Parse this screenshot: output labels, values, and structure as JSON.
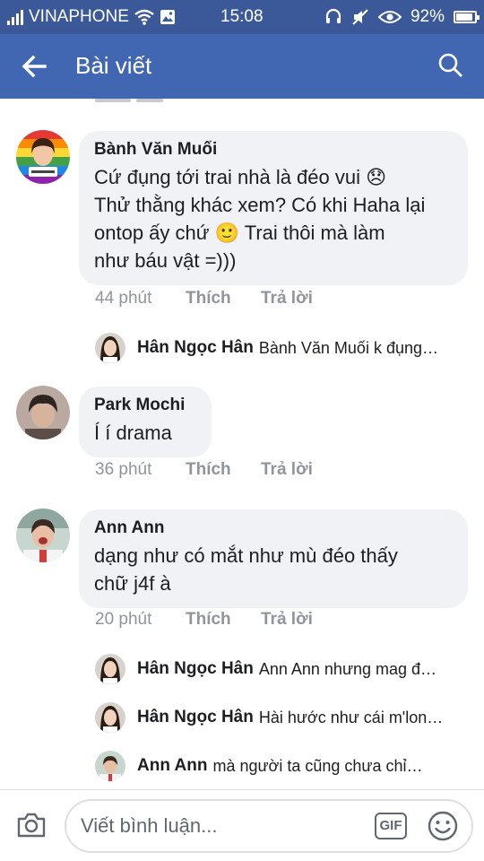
{
  "status_bar": {
    "carrier": "VINAPHONE",
    "time": "15:08",
    "battery": "92%",
    "battery_level": 0.92,
    "icons": [
      "signal-icon",
      "wifi-icon",
      "gallery-icon",
      "headset-icon",
      "mute-icon",
      "eye-icon",
      "battery-icon"
    ]
  },
  "app_bar": {
    "title": "Bài viết",
    "icons": [
      "back-arrow-icon",
      "search-icon"
    ]
  },
  "comments": [
    {
      "author": "Bành Văn Muối",
      "text": "Cứ đụng tới trai nhà là đéo vui 😞\nThử thằng khác xem? Có khi Haha lại\nontop ấy chứ 🙂 Trai thôi mà làm\nnhư báu vật =)))",
      "time": "44 phút",
      "like": "Thích",
      "reply": "Trả lời",
      "replies": [
        {
          "author": "Hân Ngọc Hân",
          "text": "Bành Văn Muối k đụng…"
        }
      ]
    },
    {
      "author": "Park Mochi",
      "text": "Í í drama",
      "time": "36 phút",
      "like": "Thích",
      "reply": "Trả lời",
      "replies": []
    },
    {
      "author": "Ann Ann",
      "text": "dạng như có mắt như mù đéo thấy\nchữ j4f à",
      "time": "20 phút",
      "like": "Thích",
      "reply": "Trả lời",
      "replies": [
        {
          "author": "Hân Ngọc Hân",
          "text": "Ann Ann nhưng mag đ…"
        },
        {
          "author": "Hân Ngọc Hân",
          "text": "Hài hước như cái m'lon…"
        },
        {
          "author": "Ann Ann",
          "text": "mà người ta cũng chưa chỉ…"
        }
      ]
    }
  ],
  "composer": {
    "placeholder": "Viết bình luận...",
    "gif_label": "GIF",
    "icons": [
      "camera-icon",
      "gif-icon",
      "smile-icon"
    ]
  },
  "colors": {
    "status_bar": "#3b5998",
    "app_bar": "#4267b2",
    "bubble": "#f0f2f5",
    "meta_text": "#90949c"
  }
}
